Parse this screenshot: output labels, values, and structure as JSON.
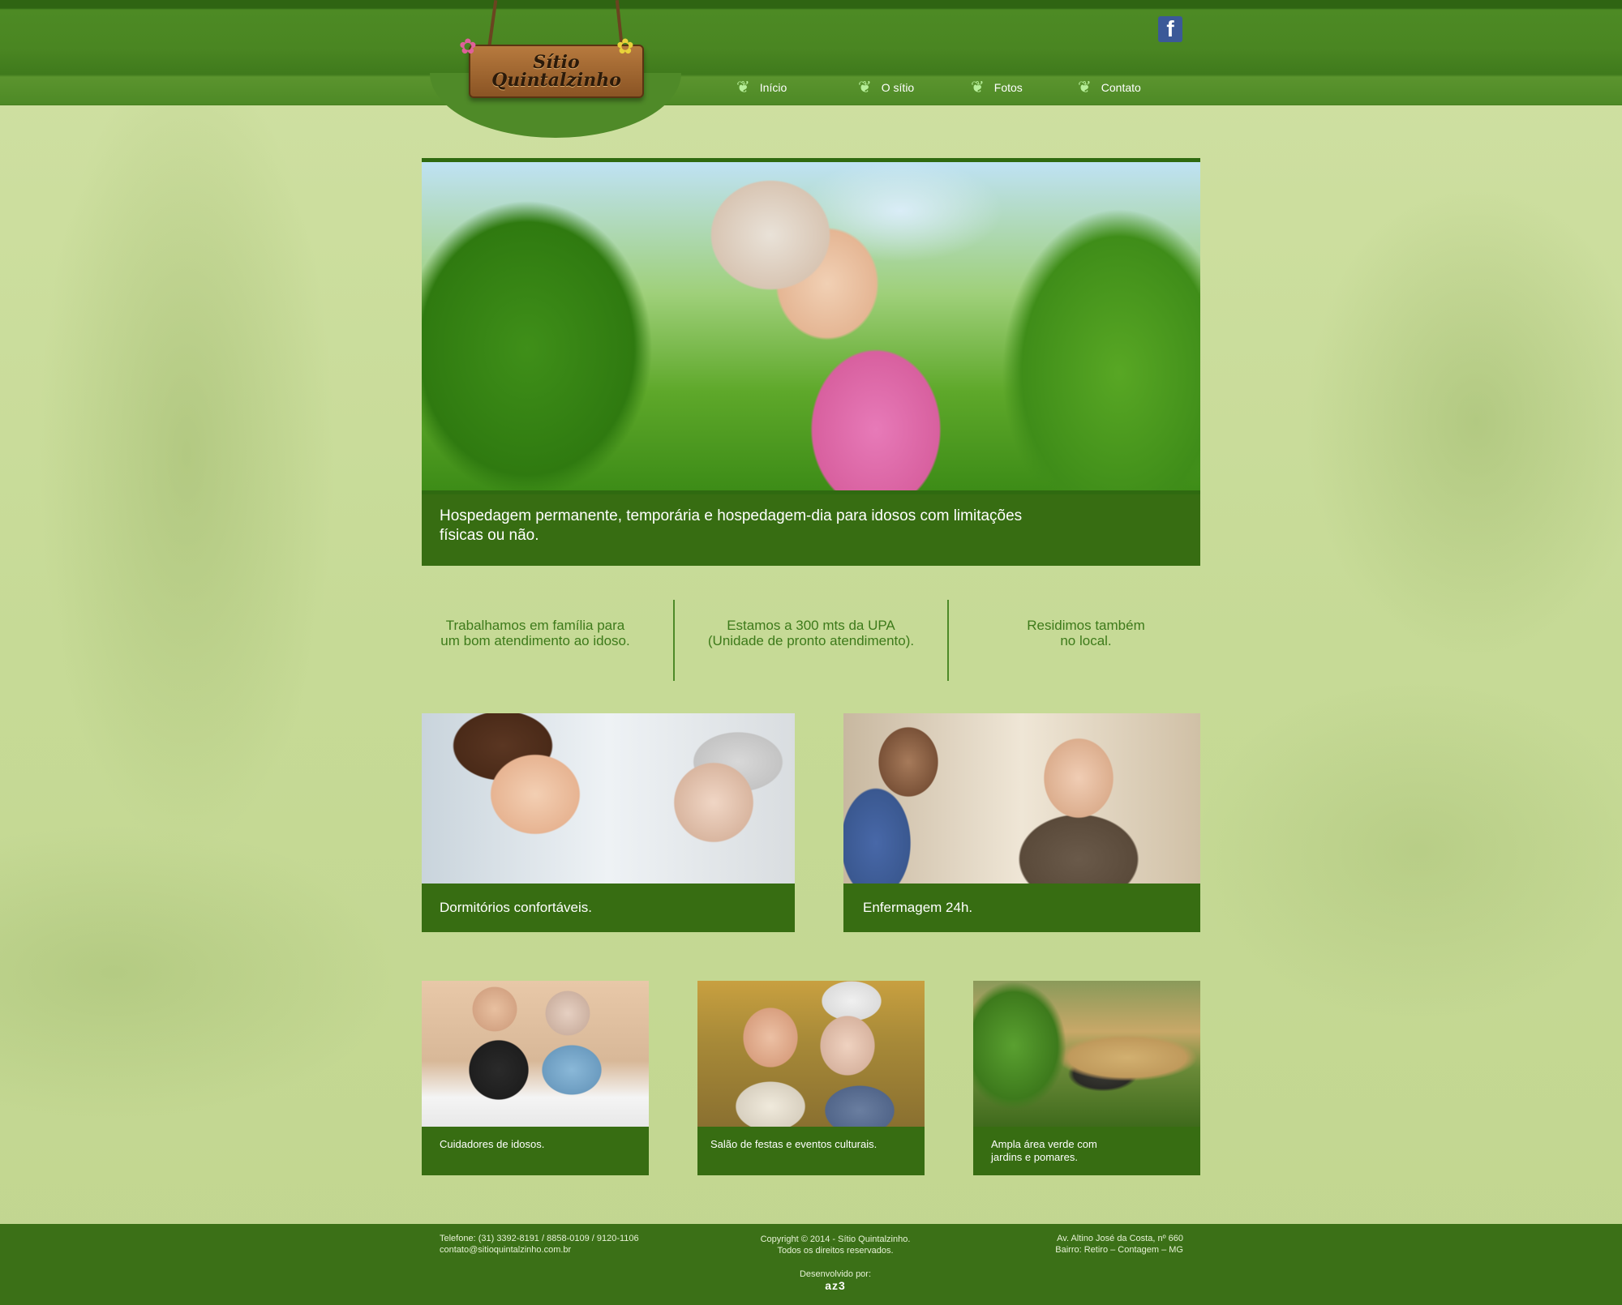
{
  "brand": {
    "logo_line1": "Sítio",
    "logo_line2": "Quintalzinho",
    "primary_color": "#376d12",
    "background_color": "#c7d996",
    "text_green": "#3d7a1a"
  },
  "social": {
    "facebook_label": "f"
  },
  "nav": {
    "items": [
      {
        "label": "Início"
      },
      {
        "label": "O sítio"
      },
      {
        "label": "Fotos"
      },
      {
        "label": "Contato"
      }
    ],
    "icon": "leaf-icon"
  },
  "hero": {
    "caption": "Hospedagem permanente, temporária e hospedagem-dia para idosos com limitações físicas ou não."
  },
  "features": [
    {
      "line1": "Trabalhamos em família para",
      "line2": "um bom atendimento ao idoso."
    },
    {
      "line1": "Estamos a 300 mts da UPA",
      "line2": "(Unidade de pronto atendimento)."
    },
    {
      "line1": "Residimos também",
      "line2": "no local."
    }
  ],
  "cards_large": [
    {
      "caption": "Dormitórios confortáveis."
    },
    {
      "caption": "Enfermagem 24h."
    }
  ],
  "cards_small": [
    {
      "caption": "Cuidadores de idosos."
    },
    {
      "caption": "Salão de festas e eventos culturais."
    },
    {
      "caption_line1": "Ampla área verde com",
      "caption_line2": "jardins e pomares."
    }
  ],
  "footer": {
    "phone": "Telefone: (31) 3392-8191 / 8858-0109 / 9120-1106",
    "email": "contato@sitioquintalzinho.com.br",
    "copyright": "Copyright © 2014 - Sítio Quintalzinho.",
    "rights": "Todos os direitos reservados.",
    "address1": "Av. Altino José da Costa, nº 660",
    "address2": "Bairro: Retiro – Contagem – MG",
    "developed_by": "Desenvolvido por:",
    "developer": "az3"
  }
}
